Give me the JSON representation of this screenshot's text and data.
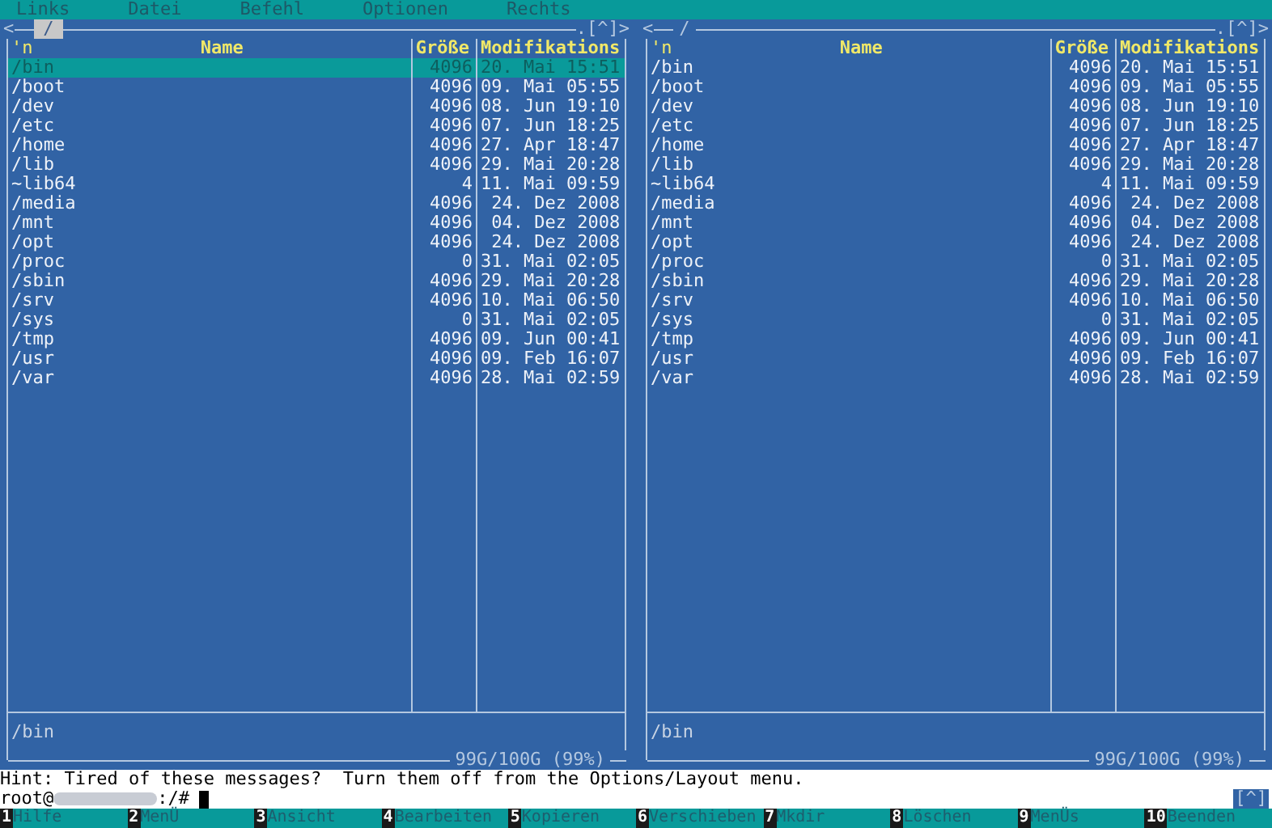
{
  "menu": [
    {
      "label": "Links"
    },
    {
      "label": "Datei"
    },
    {
      "label": "Befehl"
    },
    {
      "label": "Optionen"
    },
    {
      "label": "Rechts"
    }
  ],
  "panels": [
    {
      "active": true,
      "nav_left": "<",
      "path": "/",
      "nav_right": ".[^]>",
      "columns": [
        "'n",
        "Name",
        "Größe",
        "Modifikations"
      ],
      "rows": [
        {
          "name": "/bin",
          "size": "4096",
          "date": "20. Mai 15:51",
          "selected": true
        },
        {
          "name": "/boot",
          "size": "4096",
          "date": "09. Mai 05:55",
          "selected": false
        },
        {
          "name": "/dev",
          "size": "4096",
          "date": "08. Jun 19:10",
          "selected": false
        },
        {
          "name": "/etc",
          "size": "4096",
          "date": "07. Jun 18:25",
          "selected": false
        },
        {
          "name": "/home",
          "size": "4096",
          "date": "27. Apr 18:47",
          "selected": false
        },
        {
          "name": "/lib",
          "size": "4096",
          "date": "29. Mai 20:28",
          "selected": false
        },
        {
          "name": "~lib64",
          "size": "4",
          "date": "11. Mai 09:59",
          "selected": false
        },
        {
          "name": "/media",
          "size": "4096",
          "date": " 24. Dez 2008",
          "selected": false
        },
        {
          "name": "/mnt",
          "size": "4096",
          "date": " 04. Dez 2008",
          "selected": false
        },
        {
          "name": "/opt",
          "size": "4096",
          "date": " 24. Dez 2008",
          "selected": false
        },
        {
          "name": "/proc",
          "size": "0",
          "date": "31. Mai 02:05",
          "selected": false
        },
        {
          "name": "/sbin",
          "size": "4096",
          "date": "29. Mai 20:28",
          "selected": false
        },
        {
          "name": "/srv",
          "size": "4096",
          "date": "10. Mai 06:50",
          "selected": false
        },
        {
          "name": "/sys",
          "size": "0",
          "date": "31. Mai 02:05",
          "selected": false
        },
        {
          "name": "/tmp",
          "size": "4096",
          "date": "09. Jun 00:41",
          "selected": false
        },
        {
          "name": "/usr",
          "size": "4096",
          "date": "09. Feb 16:07",
          "selected": false
        },
        {
          "name": "/var",
          "size": "4096",
          "date": "28. Mai 02:59",
          "selected": false
        }
      ],
      "status": "/bin",
      "disk": "99G/100G (99%)"
    },
    {
      "active": false,
      "nav_left": "<",
      "path": "/",
      "nav_right": ".[^]>",
      "columns": [
        "'n",
        "Name",
        "Größe",
        "Modifikations"
      ],
      "rows": [
        {
          "name": "/bin",
          "size": "4096",
          "date": "20. Mai 15:51",
          "selected": false
        },
        {
          "name": "/boot",
          "size": "4096",
          "date": "09. Mai 05:55",
          "selected": false
        },
        {
          "name": "/dev",
          "size": "4096",
          "date": "08. Jun 19:10",
          "selected": false
        },
        {
          "name": "/etc",
          "size": "4096",
          "date": "07. Jun 18:25",
          "selected": false
        },
        {
          "name": "/home",
          "size": "4096",
          "date": "27. Apr 18:47",
          "selected": false
        },
        {
          "name": "/lib",
          "size": "4096",
          "date": "29. Mai 20:28",
          "selected": false
        },
        {
          "name": "~lib64",
          "size": "4",
          "date": "11. Mai 09:59",
          "selected": false
        },
        {
          "name": "/media",
          "size": "4096",
          "date": " 24. Dez 2008",
          "selected": false
        },
        {
          "name": "/mnt",
          "size": "4096",
          "date": " 04. Dez 2008",
          "selected": false
        },
        {
          "name": "/opt",
          "size": "4096",
          "date": " 24. Dez 2008",
          "selected": false
        },
        {
          "name": "/proc",
          "size": "0",
          "date": "31. Mai 02:05",
          "selected": false
        },
        {
          "name": "/sbin",
          "size": "4096",
          "date": "29. Mai 20:28",
          "selected": false
        },
        {
          "name": "/srv",
          "size": "4096",
          "date": "10. Mai 06:50",
          "selected": false
        },
        {
          "name": "/sys",
          "size": "0",
          "date": "31. Mai 02:05",
          "selected": false
        },
        {
          "name": "/tmp",
          "size": "4096",
          "date": "09. Jun 00:41",
          "selected": false
        },
        {
          "name": "/usr",
          "size": "4096",
          "date": "09. Feb 16:07",
          "selected": false
        },
        {
          "name": "/var",
          "size": "4096",
          "date": "28. Mai 02:59",
          "selected": false
        }
      ],
      "status": "/bin",
      "disk": "99G/100G (99%)"
    }
  ],
  "hint": "Hint: Tired of these messages?  Turn them off from the Options/Layout menu.",
  "prompt": {
    "user": "root@",
    "path": ":/#"
  },
  "scroll_marker": "[^]",
  "keybar": [
    {
      "num": "1",
      "label": "Hilfe"
    },
    {
      "num": "2",
      "label": "MenÜ"
    },
    {
      "num": "3",
      "label": "Ansicht"
    },
    {
      "num": "4",
      "label": "Bearbeiten"
    },
    {
      "num": "5",
      "label": "Kopieren"
    },
    {
      "num": "6",
      "label": "Verschieben"
    },
    {
      "num": "7",
      "label": "Mkdir"
    },
    {
      "num": "8",
      "label": "Löschen"
    },
    {
      "num": "9",
      "label": "MenÜs"
    },
    {
      "num": "10",
      "label": "Beenden"
    }
  ]
}
